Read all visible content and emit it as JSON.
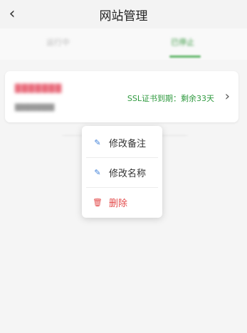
{
  "header": {
    "title": "网站管理",
    "back_icon": "back-chevron-icon"
  },
  "tabs": [
    {
      "label": "运行中"
    },
    {
      "label": "已停止"
    }
  ],
  "card": {
    "site_name": "███████",
    "site_domain": "████████",
    "ssl_text": "SSL证书到期：剩余33天",
    "chevron_icon": "chevron-right-icon"
  },
  "menu": {
    "items": [
      {
        "label": "修改备注",
        "icon": "edit-icon"
      },
      {
        "label": "修改名称",
        "icon": "edit-icon"
      },
      {
        "label": "删除",
        "icon": "trash-icon"
      }
    ]
  },
  "colors": {
    "accent_green": "#2f9a3f",
    "danger_red": "#e34b4b",
    "icon_blue": "#3d7fd8"
  }
}
